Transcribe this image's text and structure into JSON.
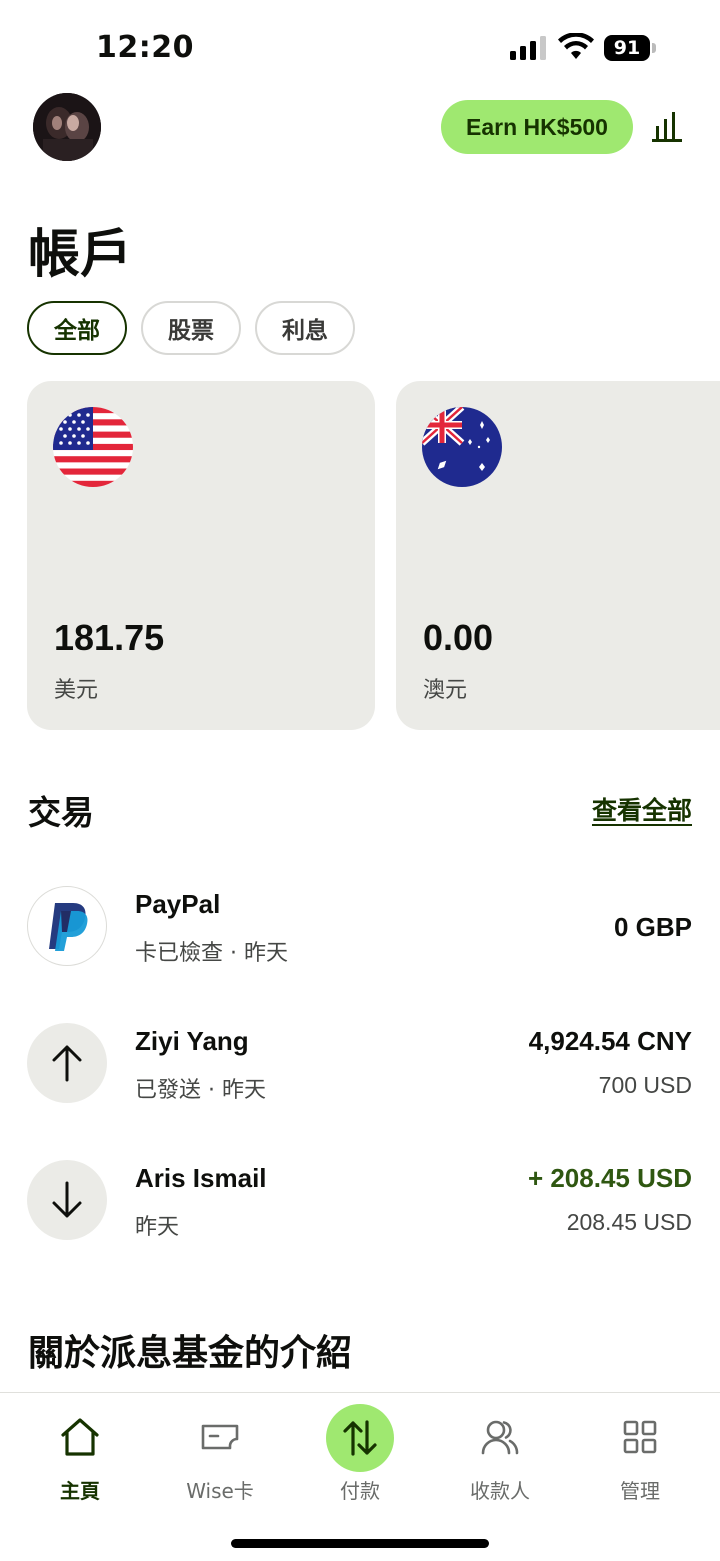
{
  "status_bar": {
    "time": "12:20",
    "battery": "91"
  },
  "header": {
    "earn_label": "Earn HK$500"
  },
  "page_title": "帳戶",
  "filters": [
    {
      "label": "全部",
      "active": true
    },
    {
      "label": "股票",
      "active": false
    },
    {
      "label": "利息",
      "active": false
    }
  ],
  "balances": [
    {
      "amount": "181.75",
      "currency": "美元",
      "flag": "us-flag-icon"
    },
    {
      "amount": "0.00",
      "currency": "澳元",
      "flag": "au-flag-icon"
    }
  ],
  "transactions_section": {
    "title": "交易",
    "see_all": "查看全部"
  },
  "transactions": [
    {
      "name": "PayPal",
      "sub": "卡已檢查 · 昨天",
      "amount": "0 GBP",
      "sub_amount": "",
      "icon": "paypal-icon"
    },
    {
      "name": "Ziyi Yang",
      "sub": "已發送 · 昨天",
      "amount": "4,924.54 CNY",
      "sub_amount": "700 USD",
      "icon": "arrow-up-icon"
    },
    {
      "name": "Aris Ismail",
      "sub": "昨天",
      "amount": "+ 208.45 USD",
      "sub_amount": "208.45 USD",
      "icon": "arrow-down-icon"
    }
  ],
  "about_title": "關於派息基金的介紹",
  "bottom_nav": [
    {
      "label": "主頁",
      "icon": "home-icon",
      "active": true
    },
    {
      "label": "Wise卡",
      "icon": "card-icon",
      "active": false
    },
    {
      "label": "付款",
      "icon": "transfer-icon",
      "active": false
    },
    {
      "label": "收款人",
      "icon": "recipients-icon",
      "active": false
    },
    {
      "label": "管理",
      "icon": "grid-icon",
      "active": false
    }
  ],
  "colors": {
    "accent": "#9fe870",
    "forest": "#163300",
    "card_bg": "#ebebe7",
    "positive": "#2f5711"
  }
}
